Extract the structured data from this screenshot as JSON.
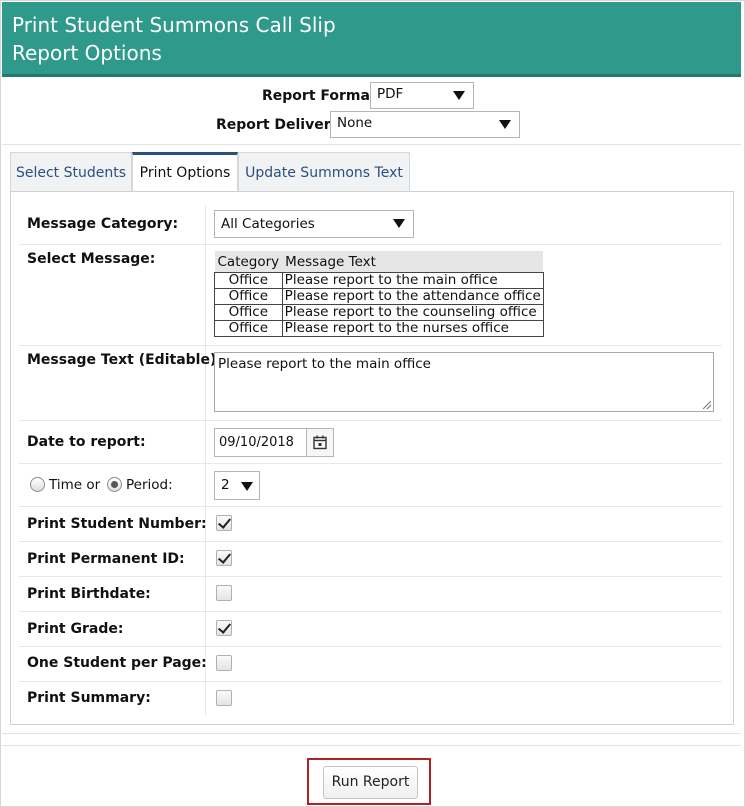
{
  "header": {
    "title_line1": "Print Student Summons Call Slip",
    "title_line2": "Report Options"
  },
  "report": {
    "format_label": "Report Format:",
    "format_value": "PDF",
    "delivery_label": "Report Delivery:",
    "delivery_value": "None"
  },
  "tabs": [
    {
      "label": "Select Students",
      "active": false
    },
    {
      "label": "Print Options",
      "active": true
    },
    {
      "label": "Update Summons Text",
      "active": false
    }
  ],
  "options": {
    "message_category_label": "Message Category:",
    "message_category_value": "All Categories",
    "select_message_label": "Select Message:",
    "message_table": {
      "headers": [
        "Category",
        "Message Text"
      ],
      "rows": [
        {
          "category": "Office",
          "text": "Please report to the main office"
        },
        {
          "category": "Office",
          "text": "Please report to the attendance office"
        },
        {
          "category": "Office",
          "text": "Please report to the counseling office"
        },
        {
          "category": "Office",
          "text": "Please report to the nurses office"
        }
      ]
    },
    "message_text_label": "Message Text (Editable):",
    "message_text_value": "Please report to the main office",
    "date_label": "Date to report:",
    "date_value": "09/10/2018",
    "time_label": "Time or",
    "period_label": "Period:",
    "period_selected": true,
    "period_value": "2",
    "checkboxes": [
      {
        "label": "Print Student Number:",
        "checked": true
      },
      {
        "label": "Print Permanent ID:",
        "checked": true
      },
      {
        "label": "Print Birthdate:",
        "checked": false
      },
      {
        "label": "Print Grade:",
        "checked": true
      },
      {
        "label": "One Student per Page:",
        "checked": false
      },
      {
        "label": "Print Summary:",
        "checked": false
      }
    ]
  },
  "actions": {
    "run_label": "Run Report"
  },
  "colors": {
    "header_bg": "#2f9a8c",
    "tab_link": "#2b4f80",
    "highlight": "#b22222"
  },
  "icons": {
    "calendar": "calendar-icon",
    "dropdown": "chevron-down-icon"
  }
}
